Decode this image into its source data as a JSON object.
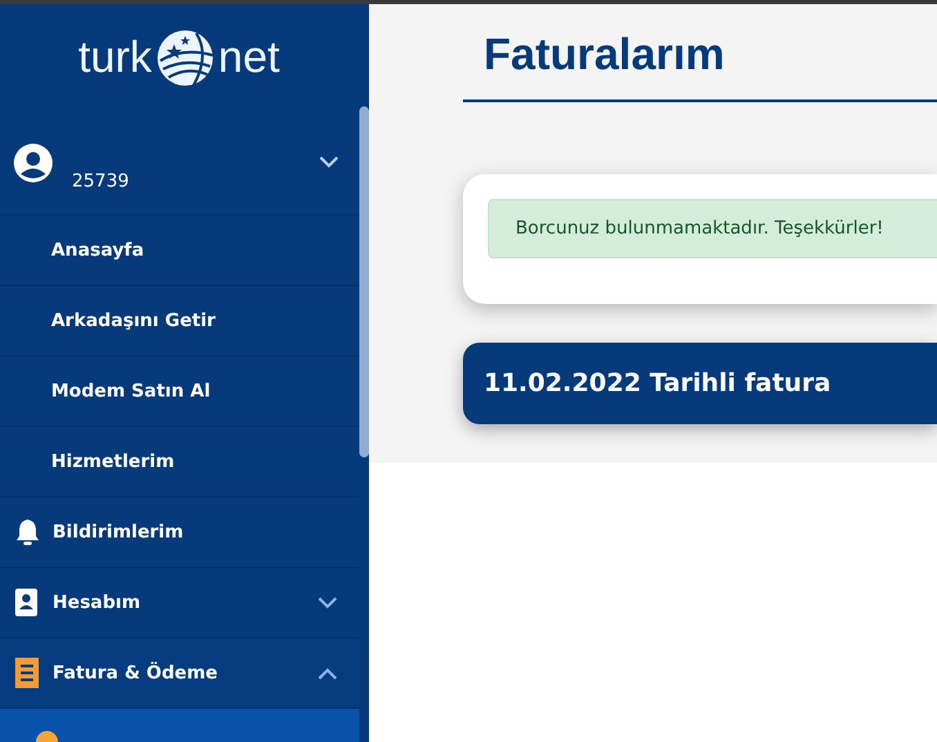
{
  "sidebar": {
    "logo": {
      "left": "turk",
      "right": "net"
    },
    "user": {
      "id": "25739",
      "expanded": false
    },
    "items": [
      {
        "kind": "sub",
        "label": "Anasayfa",
        "selected": false
      },
      {
        "kind": "sub",
        "label": "Arkadaşını Getir",
        "selected": false
      },
      {
        "kind": "sub",
        "label": "Modem Satın Al",
        "selected": false
      },
      {
        "kind": "sub",
        "label": "Hizmetlerim",
        "selected": false
      },
      {
        "kind": "bell-section",
        "label": "Bildirimlerim",
        "selected": false
      },
      {
        "kind": "card-section",
        "label": "Hesabım",
        "expanded": false,
        "selected": false
      },
      {
        "kind": "receipt-section",
        "label": "Fatura & Ödeme",
        "expanded": true,
        "selected": false
      },
      {
        "kind": "dot",
        "selected": true
      }
    ]
  },
  "main": {
    "title": "Faturalarım",
    "alert": "Borcunuz bulunmamaktadır. Teşekkürler!",
    "invoice_header": "11.02.2022 Tarihli fatura"
  }
}
